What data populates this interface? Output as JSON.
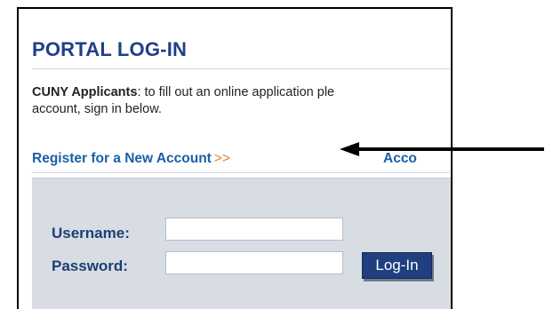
{
  "portal": {
    "title": "PORTAL LOG-IN",
    "intro_bold": "CUNY Applicants",
    "intro_rest": ": to fill out an online application ple",
    "intro_line2": "account, sign in below.",
    "register_link": "Register for a New Account",
    "register_chevrons": ">>",
    "account_link": "Acco"
  },
  "login": {
    "username_label": "Username:",
    "password_label": "Password:",
    "button_label": "Log-In"
  }
}
